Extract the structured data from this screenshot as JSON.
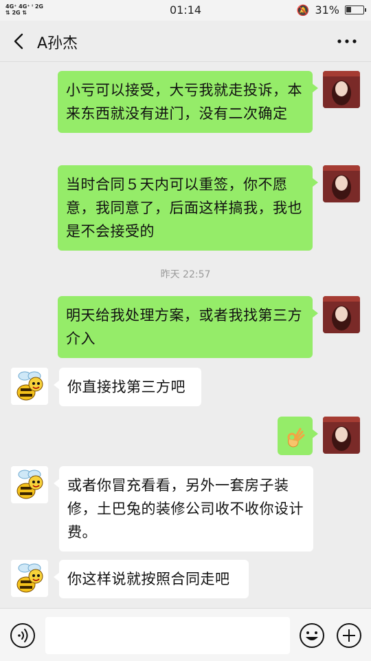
{
  "status_bar": {
    "network_top": "4G⁺ 4G⁺ ⁱ 2G",
    "network_bottom": "⇅ 2G ⇅",
    "time": "01:14",
    "battery": "31%",
    "battery_level": 0.31
  },
  "header": {
    "title": "A孙杰",
    "back_icon": "chevron-left-icon",
    "more_icon": "more-dots-icon"
  },
  "messages": [
    {
      "sender": "me",
      "text": "小亏可以接受，大亏我就走投诉，本来东西就没有进门，没有二次确定"
    },
    {
      "sender": "me",
      "text": "当时合同５天内可以重签，你不愿意，我同意了，后面这样搞我，我也是不会接受的"
    },
    {
      "type": "time",
      "text": "昨天 22:57"
    },
    {
      "sender": "me",
      "text": "明天给我处理方案，或者我找第三方介入"
    },
    {
      "sender": "other",
      "text": "你直接找第三方吧"
    },
    {
      "sender": "me",
      "emoji": "ok-hand-emoji"
    },
    {
      "sender": "other",
      "text": "或者你冒充看看，另外一套房子装修，土巴兔的装修公司收不收你设计费。"
    },
    {
      "sender": "other",
      "text": "你这样说就按照合同走吧"
    }
  ],
  "input_bar": {
    "voice_icon": "voice-icon",
    "input_value": "",
    "emoji_icon": "emoji-icon",
    "plus_icon": "plus-icon"
  },
  "colors": {
    "my_bubble": "#95ec69",
    "other_bubble": "#ffffff",
    "background": "#ededed"
  }
}
